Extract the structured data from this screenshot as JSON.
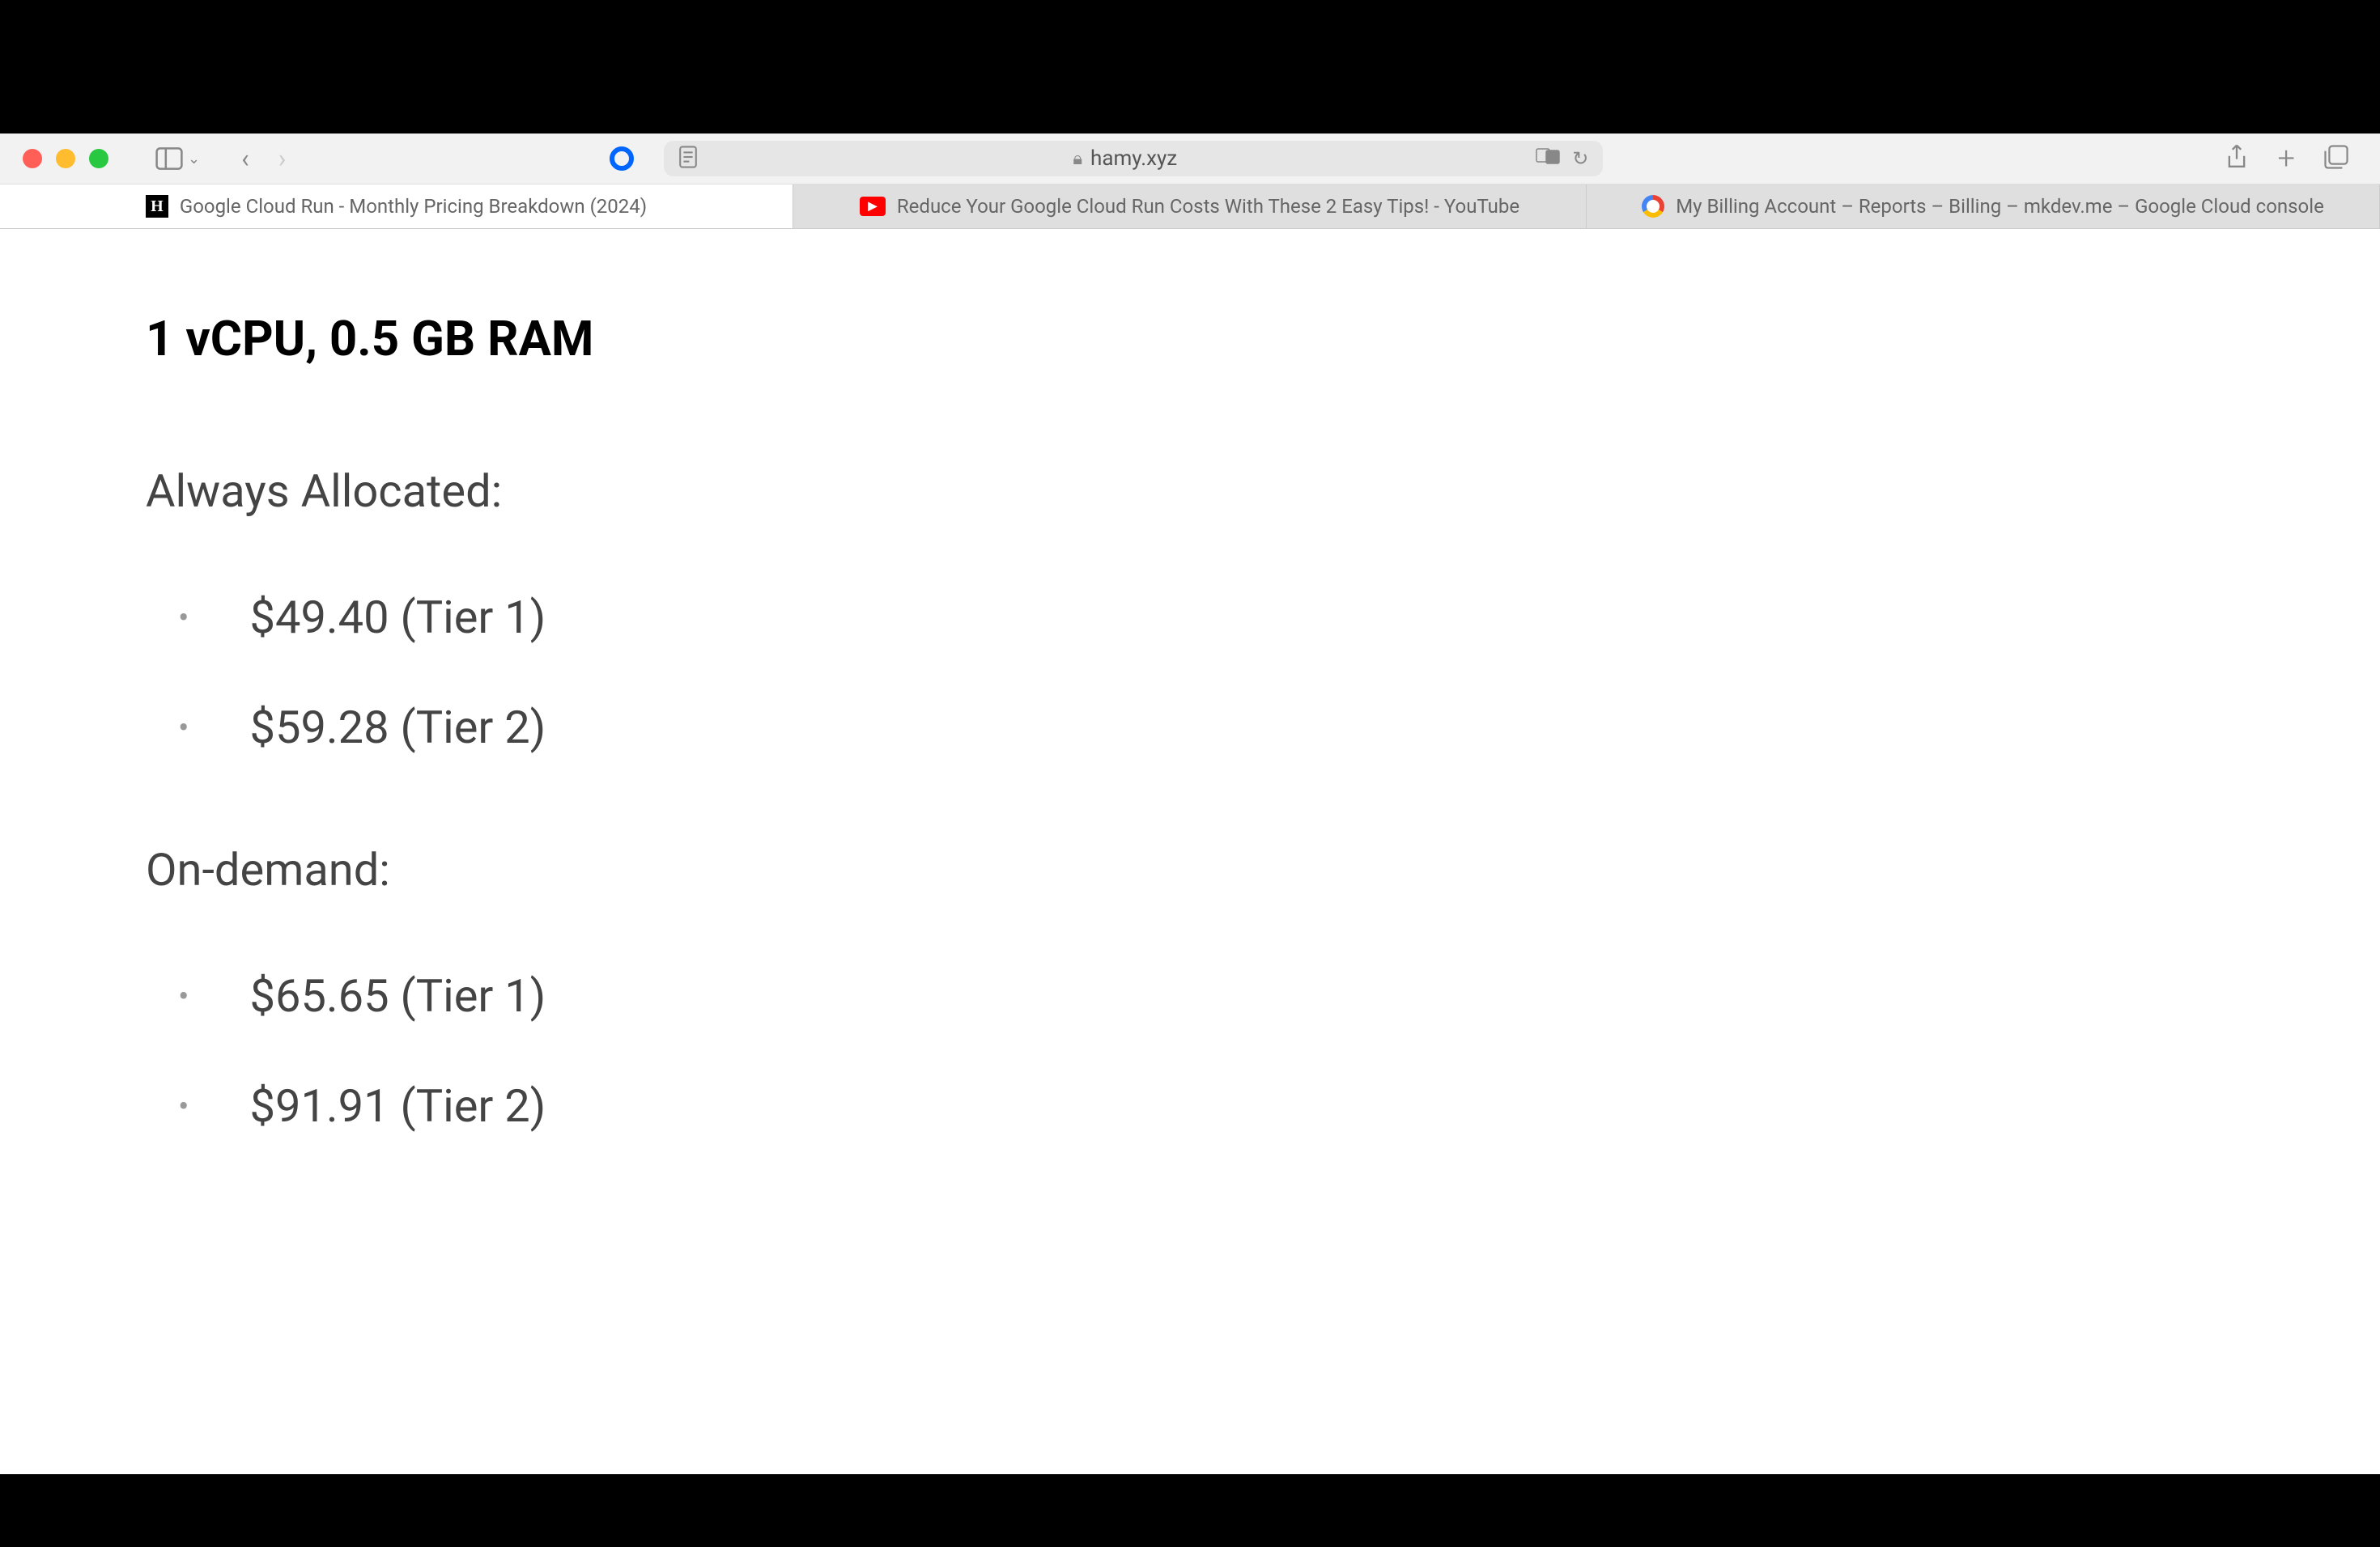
{
  "address_bar": {
    "url": "hamy.xyz"
  },
  "tabs": [
    {
      "title": "Google Cloud Run - Monthly Pricing Breakdown (2024)",
      "active": true,
      "favicon": "H"
    },
    {
      "title": "Reduce Your Google Cloud Run Costs With These 2 Easy Tips! - YouTube",
      "active": false,
      "favicon": "yt"
    },
    {
      "title": "My Billing Account – Reports – Billing – mkdev.me – Google Cloud console",
      "active": false,
      "favicon": "gc"
    }
  ],
  "content": {
    "heading": "1 vCPU, 0.5 GB RAM",
    "sections": [
      {
        "label": "Always Allocated:",
        "items": [
          "$49.40 (Tier 1)",
          "$59.28 (Tier 2)"
        ]
      },
      {
        "label": "On-demand:",
        "items": [
          "$65.65 (Tier 1)",
          "$91.91 (Tier 2)"
        ]
      }
    ]
  }
}
